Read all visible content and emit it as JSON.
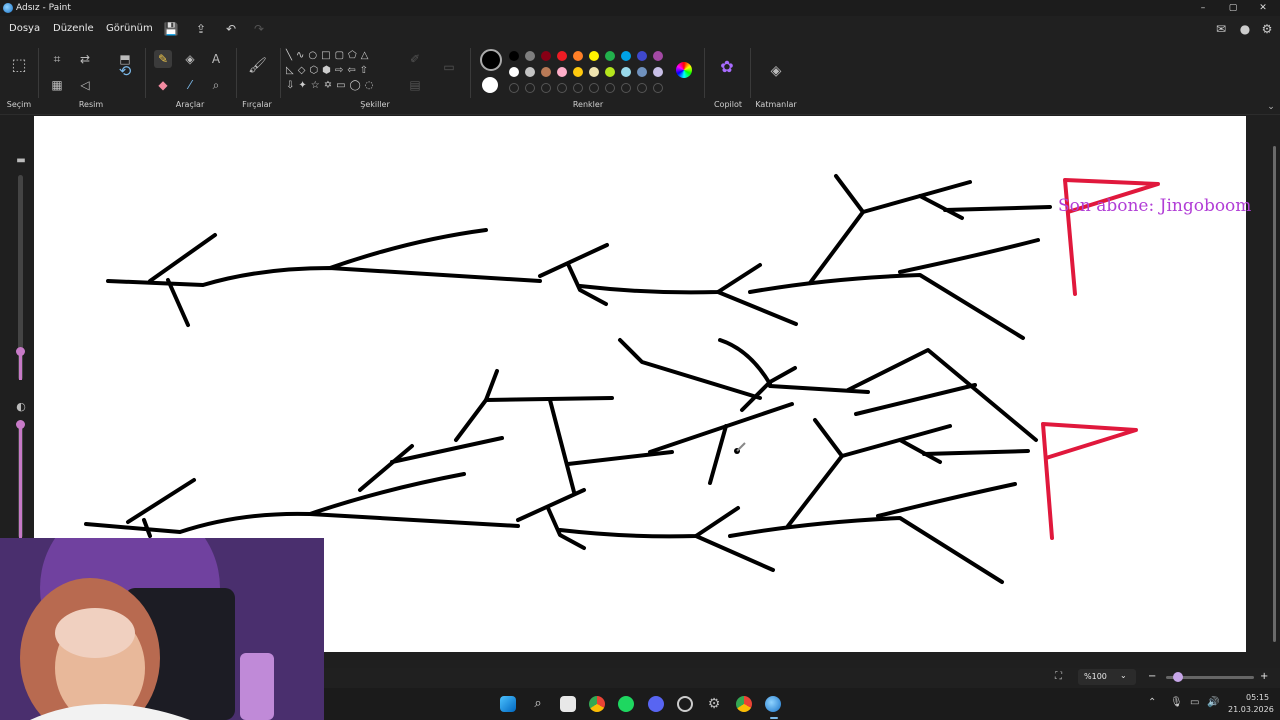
{
  "window": {
    "title": "Adsız - Paint",
    "controls": [
      "–",
      "▢",
      "✕"
    ]
  },
  "menu": {
    "items": [
      "Dosya",
      "Düzenle",
      "Görünüm"
    ]
  },
  "ribbon": {
    "groups": {
      "selection": "Seçim",
      "image": "Resim",
      "tools": "Araçlar",
      "brushes": "Fırçalar",
      "shapes": "Şekiller",
      "colors": "Renkler",
      "copilot": "Copilot",
      "layers": "Katmanlar"
    },
    "palette_row1": [
      "#000000",
      "#7f7f7f",
      "#880015",
      "#ed1c24",
      "#ff7f27",
      "#fff200",
      "#22b14c",
      "#00a2e8",
      "#3f48cc",
      "#a349a4"
    ],
    "palette_row2": [
      "#ffffff",
      "#c3c3c3",
      "#b97a57",
      "#ffaec9",
      "#ffc90e",
      "#efe4b0",
      "#b5e61d",
      "#99d9ea",
      "#7092be",
      "#c8bfe7"
    ],
    "primary_color": "#000000",
    "secondary_color": "#ffffff"
  },
  "canvas": {
    "overlay_text": "Son abone: Jingoboom",
    "stroke_color": "#000000",
    "flag_color": "#e0183c"
  },
  "status": {
    "zoom": "%100"
  },
  "taskbar": {
    "time": "05:15",
    "date": "21.03.2026"
  }
}
